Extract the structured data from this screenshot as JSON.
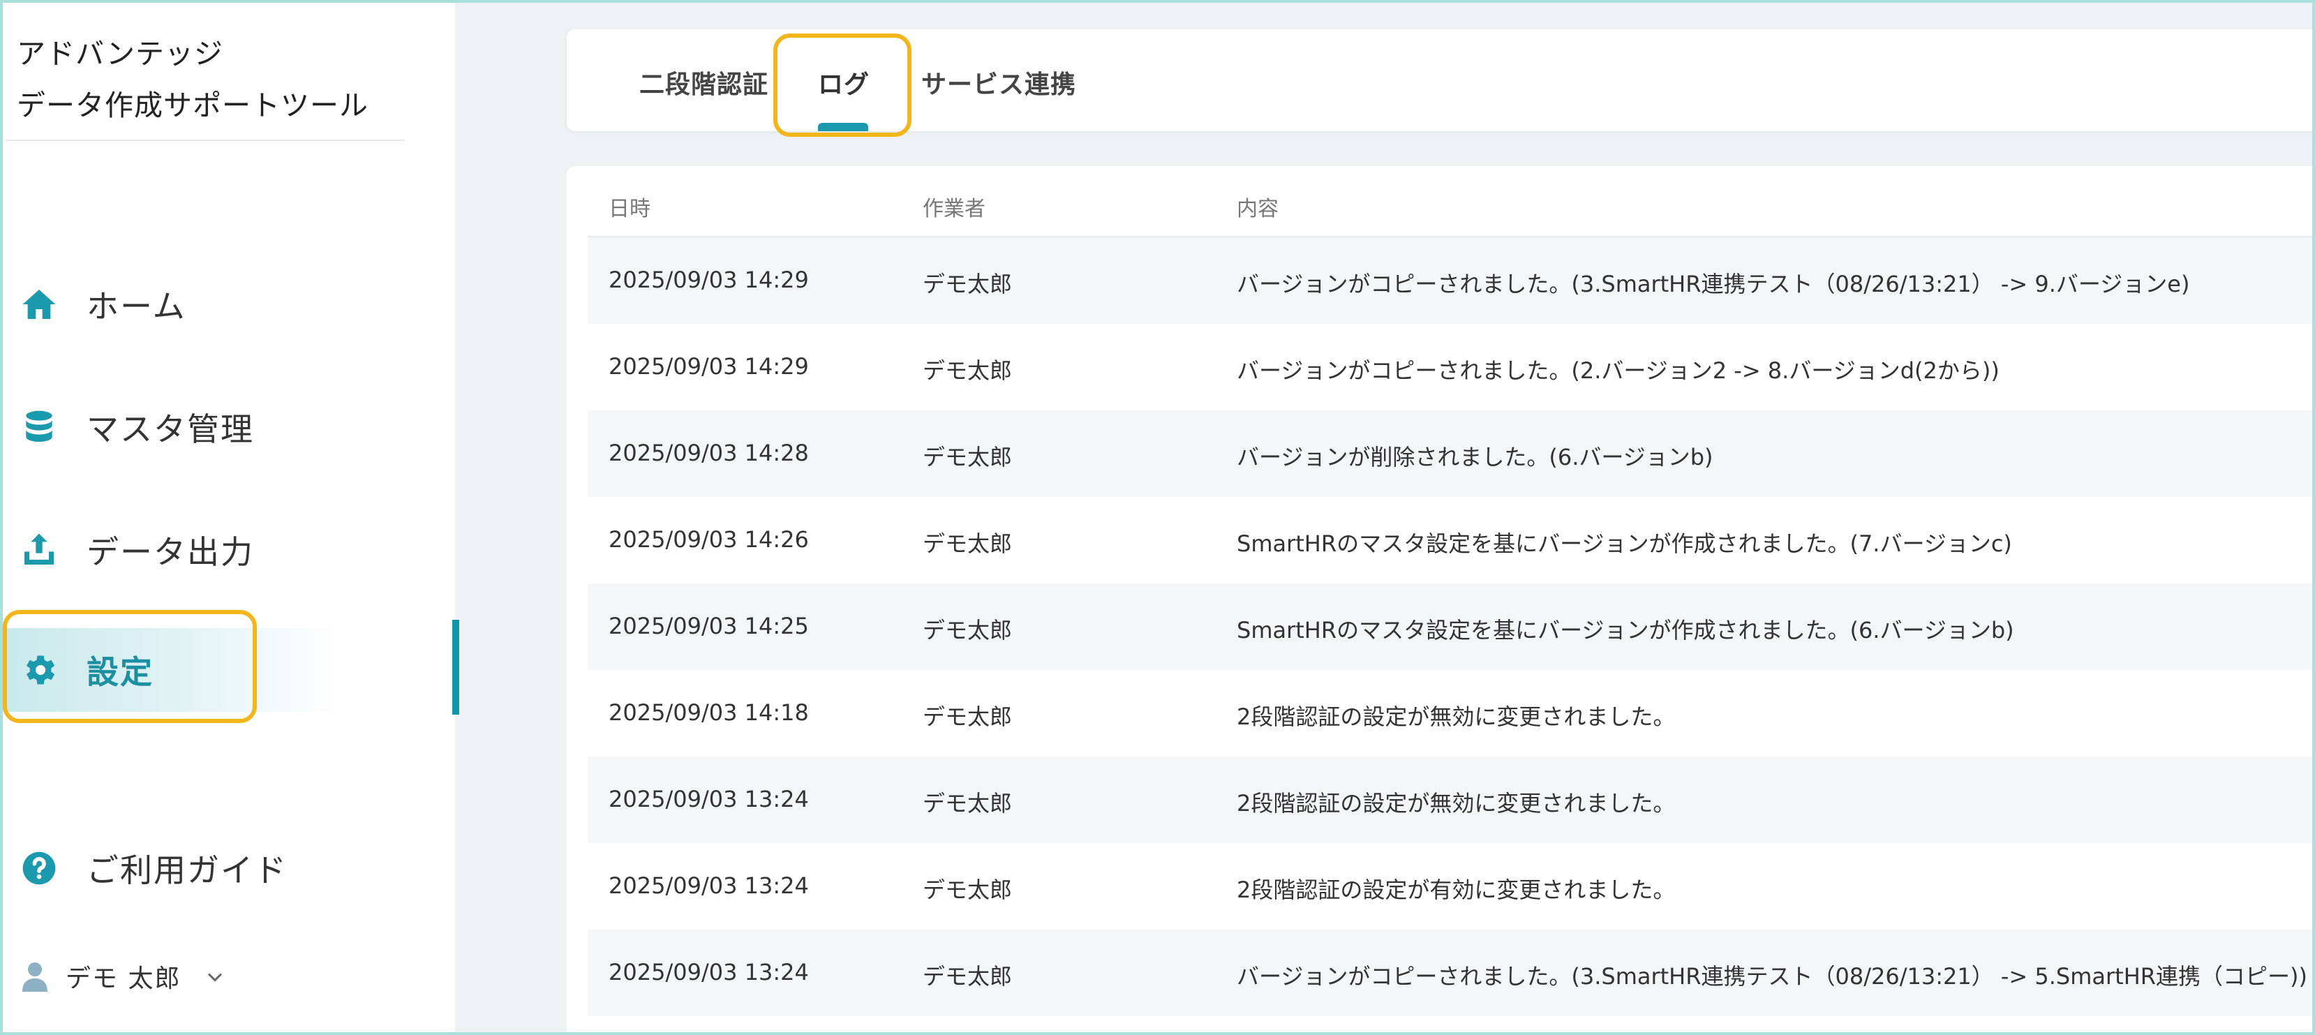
{
  "app": {
    "title_line1": "アドバンテッジ",
    "title_line2": "データ作成サポートツール"
  },
  "sidebar": {
    "items": [
      {
        "label": "ホーム",
        "icon": "home-icon"
      },
      {
        "label": "マスタ管理",
        "icon": "database-icon"
      },
      {
        "label": "データ出力",
        "icon": "upload-icon"
      },
      {
        "label": "設定",
        "icon": "gear-icon",
        "active": true
      },
      {
        "label": "ご利用ガイド",
        "icon": "help-icon"
      }
    ],
    "user_label": "デモ 太郎"
  },
  "tabs": [
    {
      "label": "二段階認証"
    },
    {
      "label": "ログ",
      "active": true
    },
    {
      "label": "サービス連携"
    }
  ],
  "table": {
    "headers": [
      "日時",
      "作業者",
      "内容"
    ],
    "rows": [
      [
        "2025/09/03 14:29",
        "デモ太郎",
        "バージョンがコピーされました。(3.SmartHR連携テスト（08/26/13:21） -> 9.バージョンe)"
      ],
      [
        "2025/09/03 14:29",
        "デモ太郎",
        "バージョンがコピーされました。(2.バージョン2 -> 8.バージョンd(2から))"
      ],
      [
        "2025/09/03 14:28",
        "デモ太郎",
        "バージョンが削除されました。(6.バージョンb)"
      ],
      [
        "2025/09/03 14:26",
        "デモ太郎",
        "SmartHRのマスタ設定を基にバージョンが作成されました。(7.バージョンc)"
      ],
      [
        "2025/09/03 14:25",
        "デモ太郎",
        "SmartHRのマスタ設定を基にバージョンが作成されました。(6.バージョンb)"
      ],
      [
        "2025/09/03 14:18",
        "デモ太郎",
        "2段階認証の設定が無効に変更されました。"
      ],
      [
        "2025/09/03 13:24",
        "デモ太郎",
        "2段階認証の設定が無効に変更されました。"
      ],
      [
        "2025/09/03 13:24",
        "デモ太郎",
        "2段階認証の設定が有効に変更されました。"
      ],
      [
        "2025/09/03 13:24",
        "デモ太郎",
        "バージョンがコピーされました。(3.SmartHR連携テスト（08/26/13:21） -> 5.SmartHR連携（コピー))"
      ]
    ]
  },
  "colors": {
    "accent": "#1b9aad",
    "highlight": "#f2b51a",
    "frame": "#a8e0dc"
  }
}
